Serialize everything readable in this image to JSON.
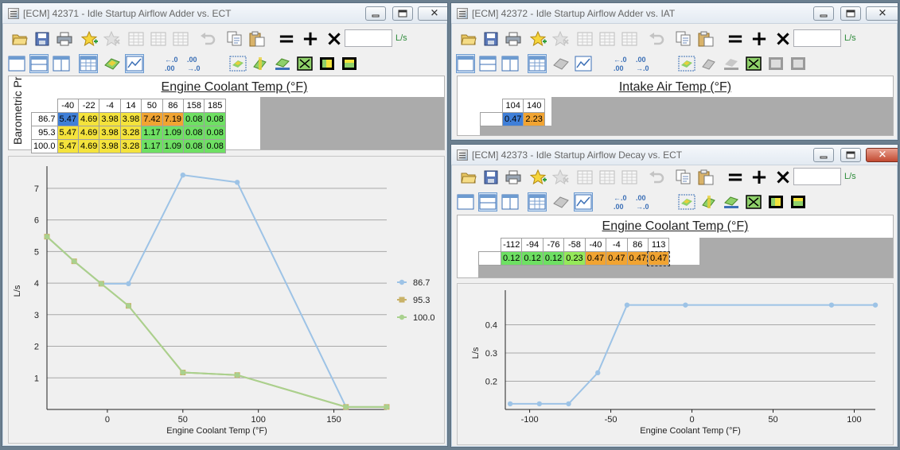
{
  "colors": {
    "blue": "#3f7fd8",
    "yellow": "#f4e33c",
    "orange": "#f1a432",
    "green": "#6ee063",
    "ltgreen": "#95e95a",
    "series1": "#9dc3e6",
    "series2": "#c9b268",
    "series3": "#a9d18e"
  },
  "icons": [
    "open-icon",
    "save-icon",
    "print-icon",
    "star-add-icon",
    "star-remove-icon",
    "table-icon",
    "table-icon",
    "table-icon",
    "undo-icon",
    "copy-icon",
    "paste-icon",
    "equals-icon",
    "plus-icon",
    "multiply-icon"
  ],
  "win1": {
    "title": "[ECM] 42371 - Idle Startup Airflow Adder vs. ECT",
    "toolbar": {
      "equals": "=",
      "plus": "+",
      "times": "×",
      "unit": "L/s",
      "value": ""
    },
    "axis_title": "Engine Coolant Temp (°F)",
    "row_axis_label": "Barometric Pressure",
    "columns": [
      "-40",
      "-22",
      "-4",
      "14",
      "50",
      "86",
      "158",
      "185"
    ],
    "rows": [
      {
        "label": "86.7",
        "cells": [
          "5.47",
          "4.69",
          "3.98",
          "3.98",
          "7.42",
          "7.19",
          "0.08",
          "0.08"
        ],
        "colors": [
          "blue",
          "yellow",
          "yellow",
          "yellow",
          "orange",
          "orange",
          "green",
          "green"
        ]
      },
      {
        "label": "95.3",
        "cells": [
          "5.47",
          "4.69",
          "3.98",
          "3.28",
          "1.17",
          "1.09",
          "0.08",
          "0.08"
        ],
        "colors": [
          "yellow",
          "yellow",
          "yellow",
          "yellow",
          "green",
          "green",
          "green",
          "green"
        ]
      },
      {
        "label": "100.0",
        "cells": [
          "5.47",
          "4.69",
          "3.98",
          "3.28",
          "1.17",
          "1.09",
          "0.08",
          "0.08"
        ],
        "colors": [
          "yellow",
          "yellow",
          "yellow",
          "yellow",
          "green",
          "green",
          "green",
          "green"
        ]
      }
    ]
  },
  "win2": {
    "title": "[ECM] 42372 - Idle Startup Airflow Adder vs. IAT",
    "toolbar": {
      "equals": "=",
      "plus": "+",
      "times": "×",
      "unit": "L/s",
      "value": ""
    },
    "axis_title": "Intake Air Temp (°F)",
    "columns": [
      "104",
      "140"
    ],
    "cells": [
      "0.47",
      "2.23"
    ],
    "colors": [
      "blue",
      "orange"
    ]
  },
  "win3": {
    "title": "[ECM] 42373 - Idle Startup Airflow Decay vs. ECT",
    "toolbar": {
      "equals": "=",
      "plus": "+",
      "times": "×",
      "unit": "L/s",
      "value": ""
    },
    "axis_title": "Engine Coolant Temp (°F)",
    "columns": [
      "-112",
      "-94",
      "-76",
      "-58",
      "-40",
      "-4",
      "86",
      "113"
    ],
    "cells": [
      "0.12",
      "0.12",
      "0.12",
      "0.23",
      "0.47",
      "0.47",
      "0.47",
      "0.47"
    ],
    "colors": [
      "green",
      "green",
      "green",
      "ltgreen",
      "orange",
      "orange",
      "orange",
      "orange"
    ]
  },
  "chart_data": [
    {
      "type": "line",
      "xlabel": "Engine Coolant Temp (°F)",
      "ylabel": "L/s",
      "xlim": [
        -40,
        185
      ],
      "ylim": [
        0,
        7.5
      ],
      "xticks": [
        "0",
        "50",
        "100",
        "150"
      ],
      "yticks": [
        "1",
        "2",
        "3",
        "4",
        "5",
        "6",
        "7"
      ],
      "x": [
        -40,
        -22,
        -4,
        14,
        50,
        86,
        158,
        185
      ],
      "series": [
        {
          "name": "86.7",
          "values": [
            5.47,
            4.69,
            3.98,
            3.98,
            7.42,
            7.19,
            0.08,
            0.08
          ]
        },
        {
          "name": "95.3",
          "values": [
            5.47,
            4.69,
            3.98,
            3.28,
            1.17,
            1.09,
            0.08,
            0.08
          ]
        },
        {
          "name": "100.0",
          "values": [
            5.47,
            4.69,
            3.98,
            3.28,
            1.17,
            1.09,
            0.08,
            0.08
          ]
        }
      ],
      "legend": "right",
      "grid": true
    },
    {
      "type": "line",
      "xlabel": "Engine Coolant Temp (°F)",
      "ylabel": "L/s",
      "xlim": [
        -115,
        113
      ],
      "ylim": [
        0.1,
        0.5
      ],
      "xticks": [
        "-100",
        "-50",
        "0",
        "50",
        "100"
      ],
      "yticks": [
        "0.2",
        "0.3",
        "0.4"
      ],
      "x": [
        -112,
        -94,
        -76,
        -58,
        -40,
        -4,
        86,
        113
      ],
      "series": [
        {
          "values": [
            0.12,
            0.12,
            0.12,
            0.23,
            0.47,
            0.47,
            0.47,
            0.47
          ]
        }
      ],
      "grid": true
    }
  ]
}
